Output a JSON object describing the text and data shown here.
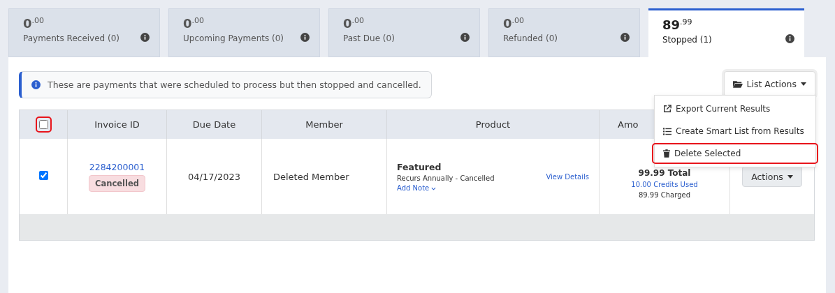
{
  "tabs": [
    {
      "amount": "0",
      "cents": ".00",
      "label": "Payments Received (0)",
      "selected": false
    },
    {
      "amount": "0",
      "cents": ".00",
      "label": "Upcoming Payments (0)",
      "selected": false
    },
    {
      "amount": "0",
      "cents": ".00",
      "label": "Past Due (0)",
      "selected": false
    },
    {
      "amount": "0",
      "cents": ".00",
      "label": "Refunded (0)",
      "selected": false
    },
    {
      "amount": "89",
      "cents": ".99",
      "label": "Stopped (1)",
      "selected": true
    }
  ],
  "alert": {
    "text": "These are payments that were scheduled to process but then stopped and cancelled."
  },
  "list_actions": {
    "label": "List Actions",
    "menu": [
      {
        "label": "Export Current Results",
        "kind": "export",
        "highlighted": false
      },
      {
        "label": "Create Smart List from Results",
        "kind": "list",
        "highlighted": false
      },
      {
        "label": "Delete Selected",
        "kind": "trash",
        "highlighted": true
      }
    ]
  },
  "table": {
    "select_all": {
      "checked": false,
      "highlighted": true
    },
    "columns": [
      "Invoice ID",
      "Due Date",
      "Member",
      "Product",
      "Amo"
    ],
    "rows": [
      {
        "checked": true,
        "invoice_id": "2284200001",
        "status": "Cancelled",
        "due_date": "04/17/2023",
        "member": "Deleted Member",
        "product": "Featured",
        "product_detail": "Recurs Annually - Cancelled",
        "add_note": "Add Note",
        "view_details": "View Details",
        "total": "99.99 Total",
        "credits": "10.00 Credits Used",
        "charged": "89.99 Charged",
        "actions": "Actions"
      }
    ]
  }
}
